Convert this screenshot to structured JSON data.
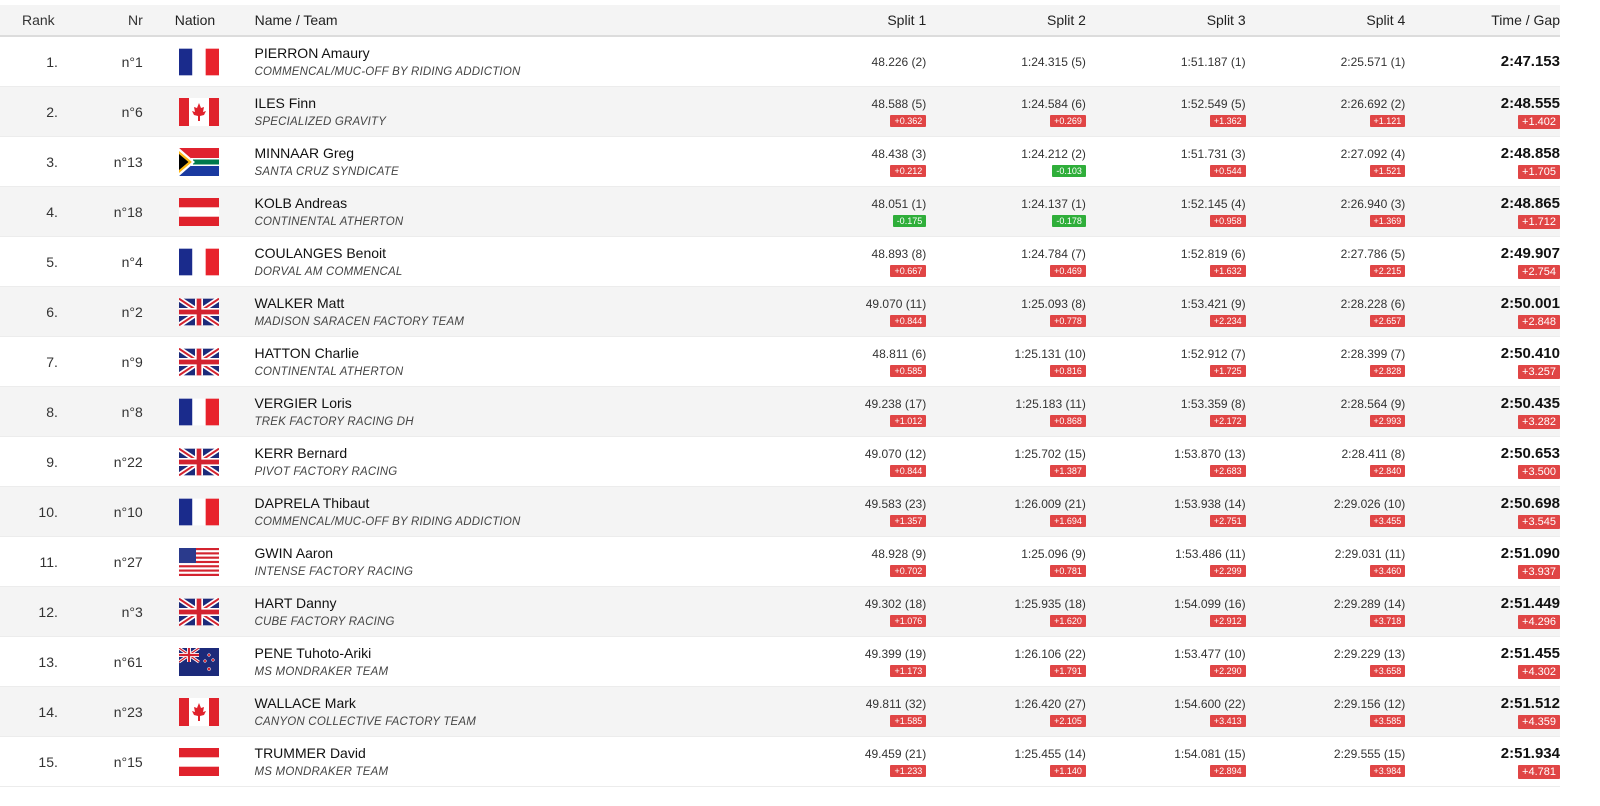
{
  "headers": {
    "rank": "Rank",
    "nr": "Nr",
    "nation": "Nation",
    "name_team": "Name / Team",
    "split1": "Split 1",
    "split2": "Split 2",
    "split3": "Split 3",
    "split4": "Split 4",
    "time_gap": "Time / Gap"
  },
  "colors": {
    "gap_positive": "#e04545",
    "gap_negative": "#2fae3a"
  },
  "rows": [
    {
      "rank": "1.",
      "nr": "n°1",
      "flag": "france-flag",
      "name": "PIERRON Amaury",
      "team": "COMMENCAL/MUC-OFF BY RIDING ADDICTION",
      "s1": "48.226 (2)",
      "g1": "",
      "s2": "1:24.315 (5)",
      "g2": "",
      "s3": "1:51.187 (1)",
      "g3": "",
      "s4": "2:25.571 (1)",
      "g4": "",
      "time": "2:47.153",
      "gap": ""
    },
    {
      "rank": "2.",
      "nr": "n°6",
      "flag": "canada-flag",
      "name": "ILES Finn",
      "team": "SPECIALIZED GRAVITY",
      "s1": "48.588 (5)",
      "g1": "+0.362",
      "s2": "1:24.584 (6)",
      "g2": "+0.269",
      "s3": "1:52.549 (5)",
      "g3": "+1.362",
      "s4": "2:26.692 (2)",
      "g4": "+1.121",
      "time": "2:48.555",
      "gap": "+1.402"
    },
    {
      "rank": "3.",
      "nr": "n°13",
      "flag": "south-africa-flag",
      "name": "MINNAAR Greg",
      "team": "SANTA CRUZ SYNDICATE",
      "s1": "48.438 (3)",
      "g1": "+0.212",
      "s2": "1:24.212 (2)",
      "g2": "-0.103",
      "s3": "1:51.731 (3)",
      "g3": "+0.544",
      "s4": "2:27.092 (4)",
      "g4": "+1.521",
      "time": "2:48.858",
      "gap": "+1.705"
    },
    {
      "rank": "4.",
      "nr": "n°18",
      "flag": "austria-flag",
      "name": "KOLB Andreas",
      "team": "CONTINENTAL ATHERTON",
      "s1": "48.051 (1)",
      "g1": "-0.175",
      "s2": "1:24.137 (1)",
      "g2": "-0.178",
      "s3": "1:52.145 (4)",
      "g3": "+0.958",
      "s4": "2:26.940 (3)",
      "g4": "+1.369",
      "time": "2:48.865",
      "gap": "+1.712"
    },
    {
      "rank": "5.",
      "nr": "n°4",
      "flag": "france-flag",
      "name": "COULANGES Benoit",
      "team": "DORVAL AM COMMENCAL",
      "s1": "48.893 (8)",
      "g1": "+0.667",
      "s2": "1:24.784 (7)",
      "g2": "+0.469",
      "s3": "1:52.819 (6)",
      "g3": "+1.632",
      "s4": "2:27.786 (5)",
      "g4": "+2.215",
      "time": "2:49.907",
      "gap": "+2.754"
    },
    {
      "rank": "6.",
      "nr": "n°2",
      "flag": "uk-flag",
      "name": "WALKER Matt",
      "team": "MADISON SARACEN FACTORY TEAM",
      "s1": "49.070 (11)",
      "g1": "+0.844",
      "s2": "1:25.093 (8)",
      "g2": "+0.778",
      "s3": "1:53.421 (9)",
      "g3": "+2.234",
      "s4": "2:28.228 (6)",
      "g4": "+2.657",
      "time": "2:50.001",
      "gap": "+2.848"
    },
    {
      "rank": "7.",
      "nr": "n°9",
      "flag": "uk-flag",
      "name": "HATTON Charlie",
      "team": "CONTINENTAL ATHERTON",
      "s1": "48.811 (6)",
      "g1": "+0.585",
      "s2": "1:25.131 (10)",
      "g2": "+0.816",
      "s3": "1:52.912 (7)",
      "g3": "+1.725",
      "s4": "2:28.399 (7)",
      "g4": "+2.828",
      "time": "2:50.410",
      "gap": "+3.257"
    },
    {
      "rank": "8.",
      "nr": "n°8",
      "flag": "france-flag",
      "name": "VERGIER Loris",
      "team": "TREK FACTORY RACING DH",
      "s1": "49.238 (17)",
      "g1": "+1.012",
      "s2": "1:25.183 (11)",
      "g2": "+0.868",
      "s3": "1:53.359 (8)",
      "g3": "+2.172",
      "s4": "2:28.564 (9)",
      "g4": "+2.993",
      "time": "2:50.435",
      "gap": "+3.282"
    },
    {
      "rank": "9.",
      "nr": "n°22",
      "flag": "uk-flag",
      "name": "KERR Bernard",
      "team": "PIVOT FACTORY RACING",
      "s1": "49.070 (12)",
      "g1": "+0.844",
      "s2": "1:25.702 (15)",
      "g2": "+1.387",
      "s3": "1:53.870 (13)",
      "g3": "+2.683",
      "s4": "2:28.411 (8)",
      "g4": "+2.840",
      "time": "2:50.653",
      "gap": "+3.500"
    },
    {
      "rank": "10.",
      "nr": "n°10",
      "flag": "france-flag",
      "name": "DAPRELA Thibaut",
      "team": "COMMENCAL/MUC-OFF BY RIDING ADDICTION",
      "s1": "49.583 (23)",
      "g1": "+1.357",
      "s2": "1:26.009 (21)",
      "g2": "+1.694",
      "s3": "1:53.938 (14)",
      "g3": "+2.751",
      "s4": "2:29.026 (10)",
      "g4": "+3.455",
      "time": "2:50.698",
      "gap": "+3.545"
    },
    {
      "rank": "11.",
      "nr": "n°27",
      "flag": "usa-flag",
      "name": "GWIN Aaron",
      "team": "INTENSE FACTORY RACING",
      "s1": "48.928 (9)",
      "g1": "+0.702",
      "s2": "1:25.096 (9)",
      "g2": "+0.781",
      "s3": "1:53.486 (11)",
      "g3": "+2.299",
      "s4": "2:29.031 (11)",
      "g4": "+3.460",
      "time": "2:51.090",
      "gap": "+3.937"
    },
    {
      "rank": "12.",
      "nr": "n°3",
      "flag": "uk-flag",
      "name": "HART Danny",
      "team": "CUBE FACTORY RACING",
      "s1": "49.302 (18)",
      "g1": "+1.076",
      "s2": "1:25.935 (18)",
      "g2": "+1.620",
      "s3": "1:54.099 (16)",
      "g3": "+2.912",
      "s4": "2:29.289 (14)",
      "g4": "+3.718",
      "time": "2:51.449",
      "gap": "+4.296"
    },
    {
      "rank": "13.",
      "nr": "n°61",
      "flag": "new-zealand-flag",
      "name": "PENE Tuhoto-Ariki",
      "team": "MS MONDRAKER TEAM",
      "s1": "49.399 (19)",
      "g1": "+1.173",
      "s2": "1:26.106 (22)",
      "g2": "+1.791",
      "s3": "1:53.477 (10)",
      "g3": "+2.290",
      "s4": "2:29.229 (13)",
      "g4": "+3.658",
      "time": "2:51.455",
      "gap": "+4.302"
    },
    {
      "rank": "14.",
      "nr": "n°23",
      "flag": "canada-flag",
      "name": "WALLACE Mark",
      "team": "CANYON COLLECTIVE FACTORY TEAM",
      "s1": "49.811 (32)",
      "g1": "+1.585",
      "s2": "1:26.420 (27)",
      "g2": "+2.105",
      "s3": "1:54.600 (22)",
      "g3": "+3.413",
      "s4": "2:29.156 (12)",
      "g4": "+3.585",
      "time": "2:51.512",
      "gap": "+4.359"
    },
    {
      "rank": "15.",
      "nr": "n°15",
      "flag": "austria-flag",
      "name": "TRUMMER David",
      "team": "MS MONDRAKER TEAM",
      "s1": "49.459 (21)",
      "g1": "+1.233",
      "s2": "1:25.455 (14)",
      "g2": "+1.140",
      "s3": "1:54.081 (15)",
      "g3": "+2.894",
      "s4": "2:29.555 (15)",
      "g4": "+3.984",
      "time": "2:51.934",
      "gap": "+4.781"
    }
  ]
}
